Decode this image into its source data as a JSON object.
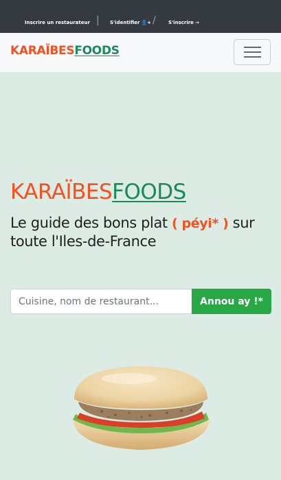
{
  "topbar": {
    "register_restaurant": "Inscrire un restaurateur",
    "login_label": "S'identifier",
    "signup_label": "S'inscrire",
    "separator_1": "|",
    "separator_2": "/"
  },
  "navbar": {
    "brand_part1": "KARAÏBES",
    "brand_part2": "FOODS"
  },
  "hero": {
    "brand_part1": "KARAÏBES",
    "brand_part2": "FOODS",
    "tagline_start": "Le guide des bons plat ",
    "tagline_highlight": "( péyi* )",
    "tagline_end": " sur toute l'Iles-de-France"
  },
  "search": {
    "placeholder": "Cuisine, nom de restaurant...",
    "button_label": "Annou ay !*"
  },
  "icons": {
    "login": "user-plus-icon",
    "signup": "sign-in-icon",
    "menu": "hamburger-icon"
  },
  "colors": {
    "topbar": "#353a40",
    "brand_orange": "#f4511e",
    "brand_green": "#1a8a5a",
    "button_green": "#28a745",
    "hero_bg": "#dcebe4"
  }
}
